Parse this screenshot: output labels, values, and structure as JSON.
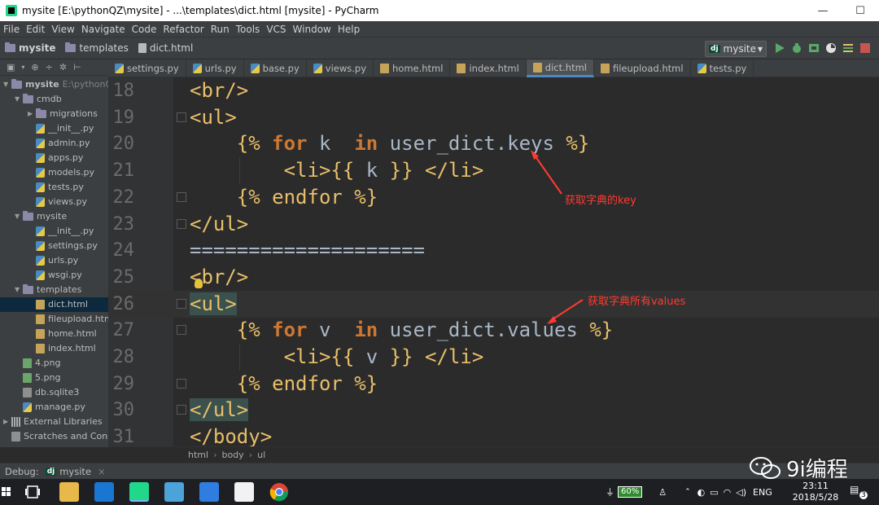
{
  "window": {
    "title": "mysite [E:\\pythonQZ\\mysite] - ...\\templates\\dict.html [mysite] - PyCharm",
    "minimize": "—",
    "maximize": "☐"
  },
  "menu": [
    "File",
    "Edit",
    "View",
    "Navigate",
    "Code",
    "Refactor",
    "Run",
    "Tools",
    "VCS",
    "Window",
    "Help"
  ],
  "navbar": {
    "crumbs": [
      "mysite",
      "templates",
      "dict.html"
    ],
    "run_config": "mysite",
    "run_config_badge": "dj"
  },
  "project_tree": [
    {
      "label": "mysite",
      "suffix": "E:\\pythonQZ",
      "type": "folder",
      "arrow": "▼",
      "bold": true
    },
    {
      "label": "cmdb",
      "type": "folder",
      "arrow": "▼"
    },
    {
      "label": "migrations",
      "type": "folder",
      "arrow": "▶"
    },
    {
      "label": "__init__.py",
      "type": "py"
    },
    {
      "label": "admin.py",
      "type": "py"
    },
    {
      "label": "apps.py",
      "type": "py"
    },
    {
      "label": "models.py",
      "type": "py"
    },
    {
      "label": "tests.py",
      "type": "py"
    },
    {
      "label": "views.py",
      "type": "py"
    },
    {
      "label": "mysite",
      "type": "folder",
      "arrow": "▼"
    },
    {
      "label": "__init__.py",
      "type": "py"
    },
    {
      "label": "settings.py",
      "type": "py"
    },
    {
      "label": "urls.py",
      "type": "py"
    },
    {
      "label": "wsgi.py",
      "type": "py"
    },
    {
      "label": "templates",
      "type": "folder",
      "arrow": "▼"
    },
    {
      "label": "dict.html",
      "type": "html",
      "selected": true
    },
    {
      "label": "fileupload.htm",
      "type": "html"
    },
    {
      "label": "home.html",
      "type": "html"
    },
    {
      "label": "index.html",
      "type": "html"
    },
    {
      "label": "4.png",
      "type": "png"
    },
    {
      "label": "5.png",
      "type": "png"
    },
    {
      "label": "db.sqlite3",
      "type": "db"
    },
    {
      "label": "manage.py",
      "type": "py"
    },
    {
      "label": "External Libraries",
      "type": "lib",
      "arrow": "▶"
    },
    {
      "label": "Scratches and Conso",
      "type": "scratch"
    }
  ],
  "tabs": [
    {
      "label": "settings.py",
      "type": "py"
    },
    {
      "label": "urls.py",
      "type": "py"
    },
    {
      "label": "base.py",
      "type": "py"
    },
    {
      "label": "views.py",
      "type": "py"
    },
    {
      "label": "home.html",
      "type": "html"
    },
    {
      "label": "index.html",
      "type": "html"
    },
    {
      "label": "dict.html",
      "type": "html",
      "active": true
    },
    {
      "label": "fileupload.html",
      "type": "html"
    },
    {
      "label": "tests.py",
      "type": "py"
    }
  ],
  "code_lines": [
    {
      "num": "18",
      "indent": 0,
      "parts": [
        [
          "tag",
          "<br/>"
        ]
      ]
    },
    {
      "num": "19",
      "indent": 0,
      "parts": [
        [
          "tag",
          "<ul>"
        ]
      ]
    },
    {
      "num": "20",
      "indent": 1,
      "parts": [
        [
          "tpl",
          "{% "
        ],
        [
          "kw",
          "for"
        ],
        [
          "var",
          " k  "
        ],
        [
          "kw",
          "in"
        ],
        [
          "var",
          " user_dict.keys "
        ],
        [
          "tpl",
          "%}"
        ]
      ]
    },
    {
      "num": "21",
      "indent": 2,
      "parts": [
        [
          "tag",
          "<li>"
        ],
        [
          "tpl",
          "{{ "
        ],
        [
          "var",
          "k"
        ],
        [
          "tpl",
          " }}"
        ],
        [
          "text",
          " "
        ],
        [
          "tag",
          "</li>"
        ]
      ]
    },
    {
      "num": "22",
      "indent": 1,
      "parts": [
        [
          "tpl",
          "{% "
        ],
        [
          "tpl",
          "endfor"
        ],
        [
          "tpl",
          " %}"
        ]
      ]
    },
    {
      "num": "23",
      "indent": 0,
      "parts": [
        [
          "tag",
          "</ul>"
        ]
      ]
    },
    {
      "num": "24",
      "indent": 0,
      "parts": [
        [
          "text",
          "===================="
        ]
      ]
    },
    {
      "num": "25",
      "indent": 0,
      "parts": [
        [
          "tag",
          "<br/>"
        ]
      ]
    },
    {
      "num": "26",
      "indent": 0,
      "current": true,
      "parts": [
        [
          "tag-hl",
          "<ul>"
        ]
      ]
    },
    {
      "num": "27",
      "indent": 1,
      "parts": [
        [
          "tpl",
          "{% "
        ],
        [
          "kw",
          "for"
        ],
        [
          "var",
          " v  "
        ],
        [
          "kw",
          "in"
        ],
        [
          "var",
          " user_dict.values "
        ],
        [
          "tpl",
          "%}"
        ]
      ]
    },
    {
      "num": "28",
      "indent": 2,
      "parts": [
        [
          "tag",
          "<li>"
        ],
        [
          "tpl",
          "{{ "
        ],
        [
          "var",
          "v"
        ],
        [
          "tpl",
          " }}"
        ],
        [
          "text",
          " "
        ],
        [
          "tag",
          "</li>"
        ]
      ]
    },
    {
      "num": "29",
      "indent": 1,
      "parts": [
        [
          "tpl",
          "{% "
        ],
        [
          "tpl",
          "endfor"
        ],
        [
          "tpl",
          " %}"
        ]
      ]
    },
    {
      "num": "30",
      "indent": 0,
      "parts": [
        [
          "tag-hl",
          "</ul>"
        ]
      ]
    },
    {
      "num": "31",
      "indent": 0,
      "parts": [
        [
          "tag",
          "</body>"
        ]
      ]
    }
  ],
  "annotations": {
    "keys": "获取字典的key",
    "values": "获取字典所有values"
  },
  "breadcrumb": [
    "html",
    "body",
    "ul"
  ],
  "debug": {
    "label": "Debug:",
    "config": "mysite",
    "badge": "dj"
  },
  "watermark": "9i编程",
  "taskbar": {
    "battery": "60%",
    "lang": "ENG",
    "time": "23:11",
    "date": "2018/5/28",
    "notifications": "3"
  },
  "colors": {
    "editor_bg": "#2b2b2b",
    "tag": "#e8bf6a",
    "keyword": "#cc7832",
    "text": "#a9b7c6",
    "annotation": "#ff3b30",
    "active_tab_underline": "#4a88c7"
  }
}
